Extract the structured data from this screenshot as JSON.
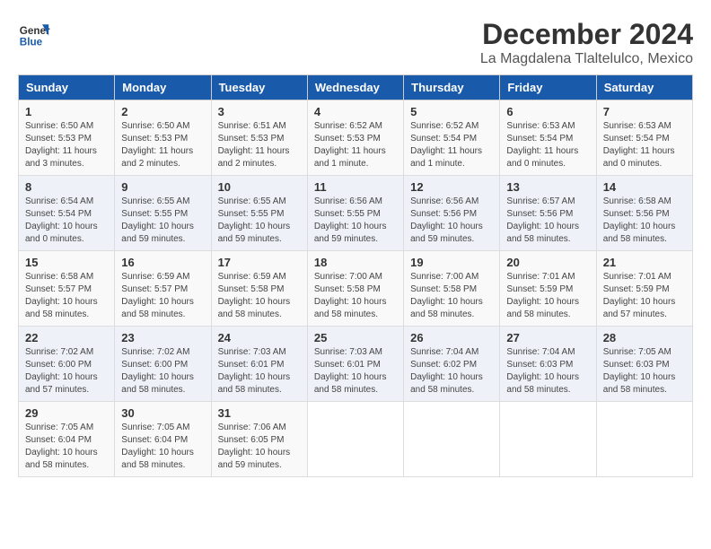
{
  "logo": {
    "general": "General",
    "blue": "Blue"
  },
  "title": "December 2024",
  "subtitle": "La Magdalena Tlaltelulco, Mexico",
  "weekdays": [
    "Sunday",
    "Monday",
    "Tuesday",
    "Wednesday",
    "Thursday",
    "Friday",
    "Saturday"
  ],
  "weeks": [
    [
      {
        "day": "1",
        "sunrise": "6:50 AM",
        "sunset": "5:53 PM",
        "daylight": "11 hours and 3 minutes."
      },
      {
        "day": "2",
        "sunrise": "6:50 AM",
        "sunset": "5:53 PM",
        "daylight": "11 hours and 2 minutes."
      },
      {
        "day": "3",
        "sunrise": "6:51 AM",
        "sunset": "5:53 PM",
        "daylight": "11 hours and 2 minutes."
      },
      {
        "day": "4",
        "sunrise": "6:52 AM",
        "sunset": "5:53 PM",
        "daylight": "11 hours and 1 minute."
      },
      {
        "day": "5",
        "sunrise": "6:52 AM",
        "sunset": "5:54 PM",
        "daylight": "11 hours and 1 minute."
      },
      {
        "day": "6",
        "sunrise": "6:53 AM",
        "sunset": "5:54 PM",
        "daylight": "11 hours and 0 minutes."
      },
      {
        "day": "7",
        "sunrise": "6:53 AM",
        "sunset": "5:54 PM",
        "daylight": "11 hours and 0 minutes."
      }
    ],
    [
      {
        "day": "8",
        "sunrise": "6:54 AM",
        "sunset": "5:54 PM",
        "daylight": "10 hours and 0 minutes."
      },
      {
        "day": "9",
        "sunrise": "6:55 AM",
        "sunset": "5:55 PM",
        "daylight": "10 hours and 59 minutes."
      },
      {
        "day": "10",
        "sunrise": "6:55 AM",
        "sunset": "5:55 PM",
        "daylight": "10 hours and 59 minutes."
      },
      {
        "day": "11",
        "sunrise": "6:56 AM",
        "sunset": "5:55 PM",
        "daylight": "10 hours and 59 minutes."
      },
      {
        "day": "12",
        "sunrise": "6:56 AM",
        "sunset": "5:56 PM",
        "daylight": "10 hours and 59 minutes."
      },
      {
        "day": "13",
        "sunrise": "6:57 AM",
        "sunset": "5:56 PM",
        "daylight": "10 hours and 58 minutes."
      },
      {
        "day": "14",
        "sunrise": "6:58 AM",
        "sunset": "5:56 PM",
        "daylight": "10 hours and 58 minutes."
      }
    ],
    [
      {
        "day": "15",
        "sunrise": "6:58 AM",
        "sunset": "5:57 PM",
        "daylight": "10 hours and 58 minutes."
      },
      {
        "day": "16",
        "sunrise": "6:59 AM",
        "sunset": "5:57 PM",
        "daylight": "10 hours and 58 minutes."
      },
      {
        "day": "17",
        "sunrise": "6:59 AM",
        "sunset": "5:58 PM",
        "daylight": "10 hours and 58 minutes."
      },
      {
        "day": "18",
        "sunrise": "7:00 AM",
        "sunset": "5:58 PM",
        "daylight": "10 hours and 58 minutes."
      },
      {
        "day": "19",
        "sunrise": "7:00 AM",
        "sunset": "5:58 PM",
        "daylight": "10 hours and 58 minutes."
      },
      {
        "day": "20",
        "sunrise": "7:01 AM",
        "sunset": "5:59 PM",
        "daylight": "10 hours and 58 minutes."
      },
      {
        "day": "21",
        "sunrise": "7:01 AM",
        "sunset": "5:59 PM",
        "daylight": "10 hours and 57 minutes."
      }
    ],
    [
      {
        "day": "22",
        "sunrise": "7:02 AM",
        "sunset": "6:00 PM",
        "daylight": "10 hours and 57 minutes."
      },
      {
        "day": "23",
        "sunrise": "7:02 AM",
        "sunset": "6:00 PM",
        "daylight": "10 hours and 58 minutes."
      },
      {
        "day": "24",
        "sunrise": "7:03 AM",
        "sunset": "6:01 PM",
        "daylight": "10 hours and 58 minutes."
      },
      {
        "day": "25",
        "sunrise": "7:03 AM",
        "sunset": "6:01 PM",
        "daylight": "10 hours and 58 minutes."
      },
      {
        "day": "26",
        "sunrise": "7:04 AM",
        "sunset": "6:02 PM",
        "daylight": "10 hours and 58 minutes."
      },
      {
        "day": "27",
        "sunrise": "7:04 AM",
        "sunset": "6:03 PM",
        "daylight": "10 hours and 58 minutes."
      },
      {
        "day": "28",
        "sunrise": "7:05 AM",
        "sunset": "6:03 PM",
        "daylight": "10 hours and 58 minutes."
      }
    ],
    [
      {
        "day": "29",
        "sunrise": "7:05 AM",
        "sunset": "6:04 PM",
        "daylight": "10 hours and 58 minutes."
      },
      {
        "day": "30",
        "sunrise": "7:05 AM",
        "sunset": "6:04 PM",
        "daylight": "10 hours and 58 minutes."
      },
      {
        "day": "31",
        "sunrise": "7:06 AM",
        "sunset": "6:05 PM",
        "daylight": "10 hours and 59 minutes."
      },
      null,
      null,
      null,
      null
    ]
  ]
}
